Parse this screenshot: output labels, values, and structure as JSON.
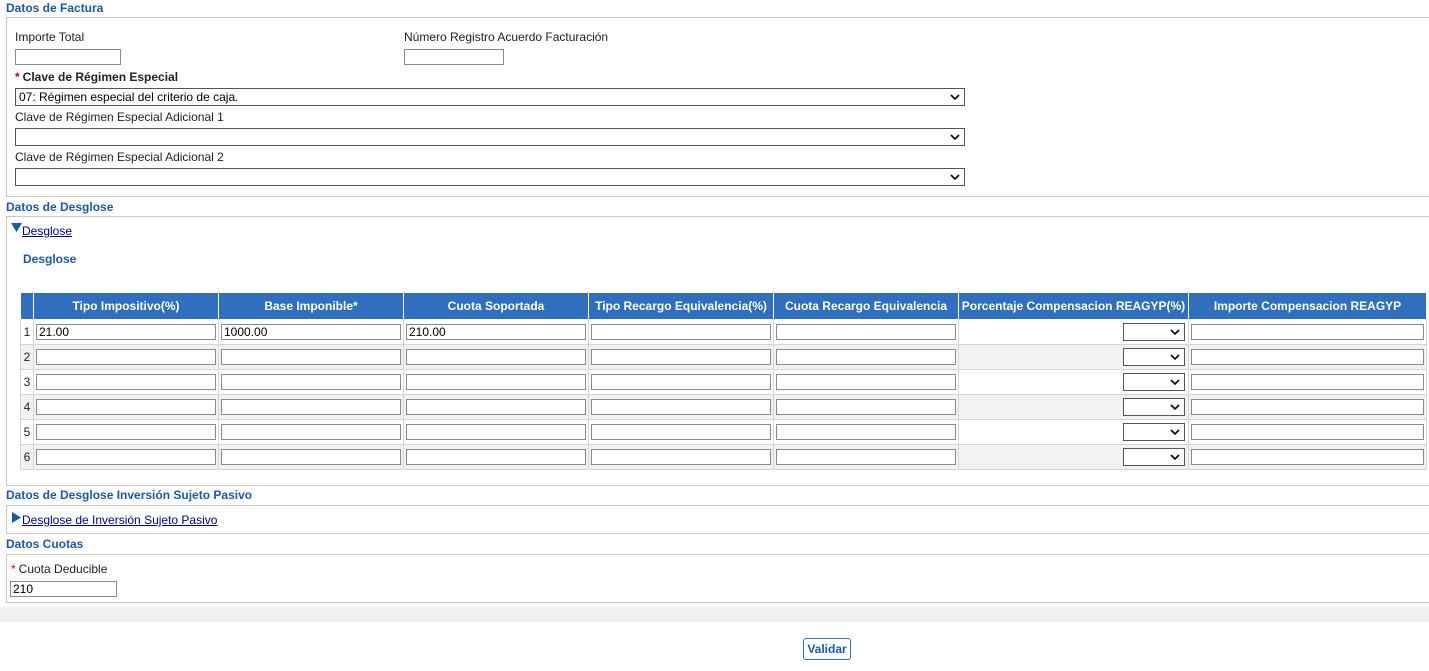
{
  "factura": {
    "section_title": "Datos de Factura",
    "importe_total_label": "Importe Total",
    "importe_total_value": "",
    "numero_registro_label": "Número Registro Acuerdo Facturación",
    "numero_registro_value": "",
    "clave_label": "Clave de Régimen Especial",
    "clave_required_mark": "*",
    "clave_value": "07: Régimen especial del criterio de caja.",
    "clave_adicional1_label": "Clave de Régimen Especial Adicional 1",
    "clave_adicional1_value": "",
    "clave_adicional2_label": "Clave de Régimen Especial Adicional 2",
    "clave_adicional2_value": ""
  },
  "desglose": {
    "section_title": "Datos de Desglose",
    "toggle_label": "Desglose",
    "toggle_icon": "triangle-down-icon",
    "subtitle": "Desglose",
    "columns": [
      "Tipo Impositivo(%)",
      "Base Imponible*",
      "Cuota Soportada",
      "Tipo Recargo Equivalencia(%)",
      "Cuota Recargo Equivalencia",
      "Porcentaje Compensacion REAGYP(%)",
      "Importe Compensacion REAGYP"
    ],
    "rows": [
      {
        "num": "1",
        "tipo": "21.00",
        "base": "1000.00",
        "cuota": "210.00",
        "tipo_recargo": "",
        "cuota_recargo": "",
        "porcentaje": "",
        "importe": ""
      },
      {
        "num": "2",
        "tipo": "",
        "base": "",
        "cuota": "",
        "tipo_recargo": "",
        "cuota_recargo": "",
        "porcentaje": "",
        "importe": ""
      },
      {
        "num": "3",
        "tipo": "",
        "base": "",
        "cuota": "",
        "tipo_recargo": "",
        "cuota_recargo": "",
        "porcentaje": "",
        "importe": ""
      },
      {
        "num": "4",
        "tipo": "",
        "base": "",
        "cuota": "",
        "tipo_recargo": "",
        "cuota_recargo": "",
        "porcentaje": "",
        "importe": ""
      },
      {
        "num": "5",
        "tipo": "",
        "base": "",
        "cuota": "",
        "tipo_recargo": "",
        "cuota_recargo": "",
        "porcentaje": "",
        "importe": ""
      },
      {
        "num": "6",
        "tipo": "",
        "base": "",
        "cuota": "",
        "tipo_recargo": "",
        "cuota_recargo": "",
        "porcentaje": "",
        "importe": ""
      }
    ]
  },
  "inversion": {
    "section_title": "Datos de Desglose Inversión Sujeto Pasivo",
    "toggle_label": "Desglose de Inversión Sujeto Pasivo",
    "toggle_icon": "triangle-right-icon"
  },
  "cuotas": {
    "section_title": "Datos Cuotas",
    "required_mark": "*",
    "cuota_deducible_label": "Cuota Deducible",
    "cuota_deducible_value": "210"
  },
  "actions": {
    "validar_label": "Validar"
  },
  "colors": {
    "accent": "#1a5aa6",
    "header_bg": "#2f6fbd",
    "required": "#c00000"
  }
}
